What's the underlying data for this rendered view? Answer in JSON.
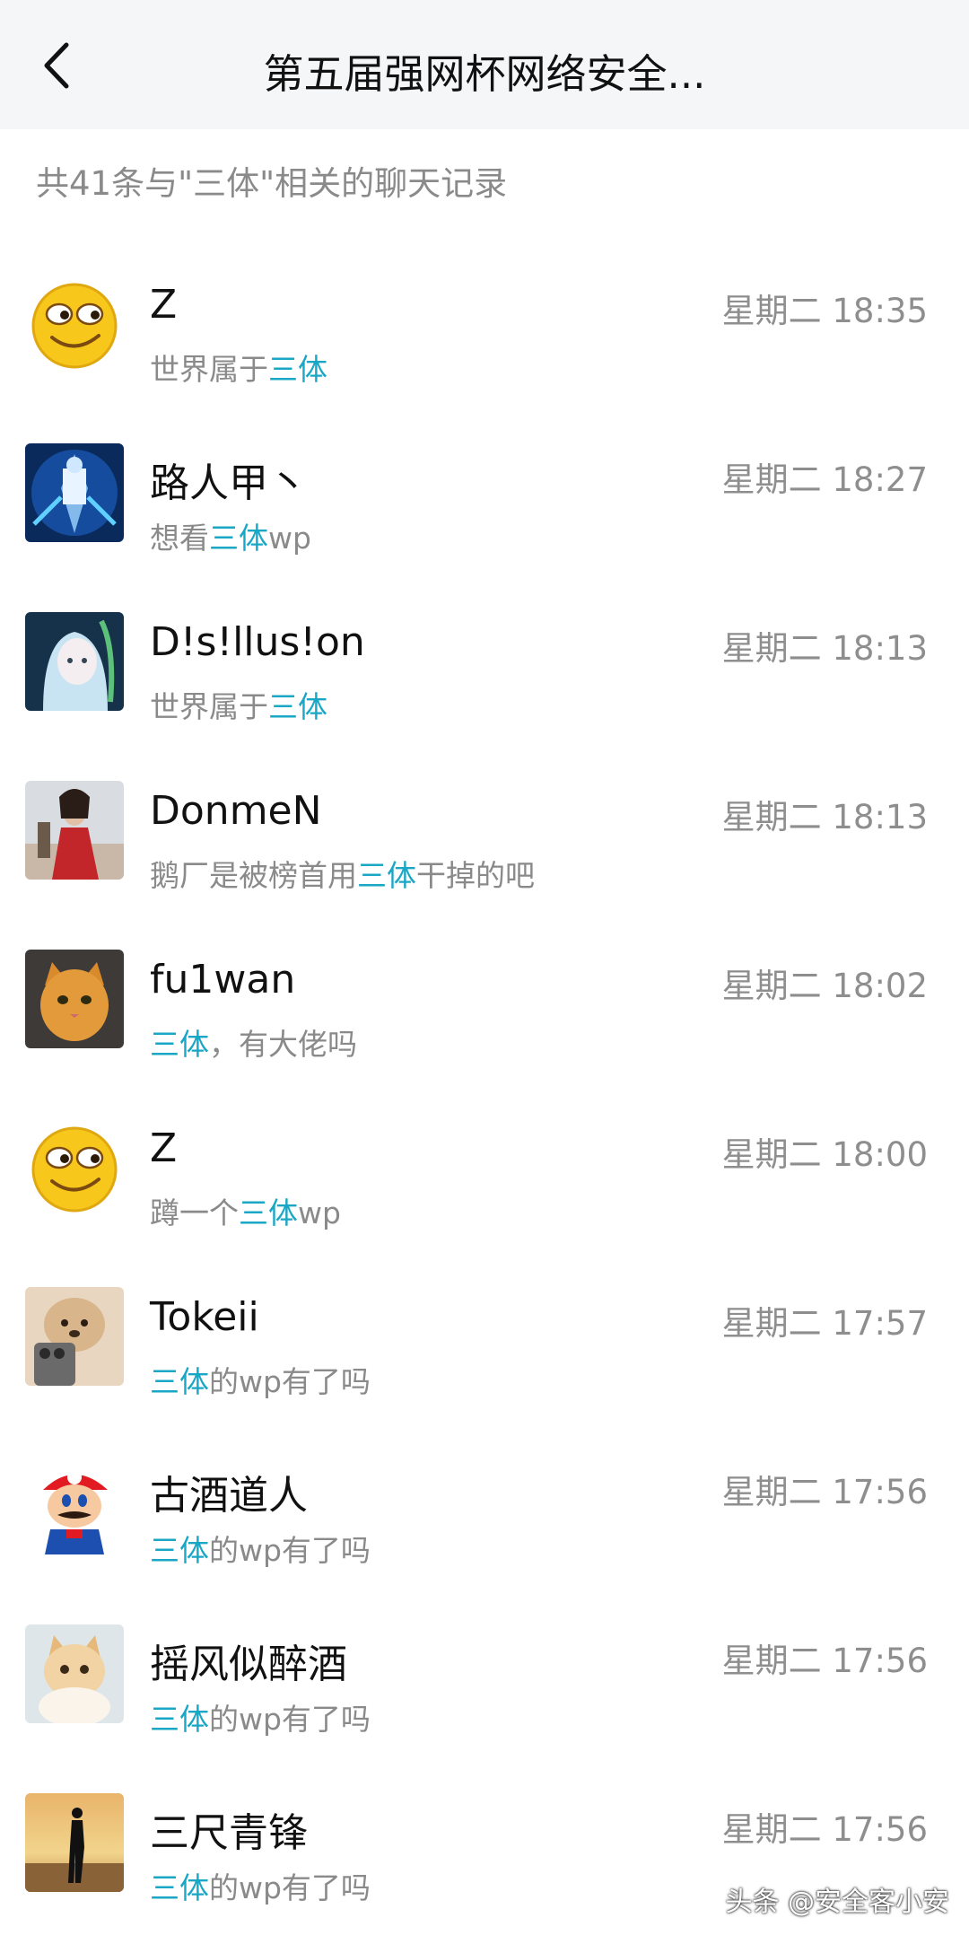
{
  "header": {
    "title": "第五届强网杯网络安全...",
    "back_icon": "chevron-left-icon"
  },
  "summary": "共41条与\"三体\"相关的聊天记录",
  "results": [
    {
      "name": "Z",
      "time": "星期二 18:35",
      "before": "世界属于",
      "keyword": "三体",
      "after": "",
      "avatar": "emoji-face"
    },
    {
      "name": "路人甲丶",
      "time": "星期二 18:27",
      "before": "想看",
      "keyword": "三体",
      "after": "wp",
      "avatar": "blue-robot"
    },
    {
      "name": "D!s!llus!on",
      "time": "星期二 18:13",
      "before": "世界属于",
      "keyword": "三体",
      "after": "",
      "avatar": "anime-girl"
    },
    {
      "name": "DonmeN",
      "time": "星期二 18:13",
      "before": "鹅厂是被榜首用",
      "keyword": "三体",
      "after": "干掉的吧",
      "avatar": "red-robe"
    },
    {
      "name": "fu1wan",
      "time": "星期二 18:02",
      "before": "",
      "keyword": "三体",
      "after": "，有大佬吗",
      "avatar": "orange-cat"
    },
    {
      "name": "Z",
      "time": "星期二 18:00",
      "before": "蹲一个",
      "keyword": "三体",
      "after": "wp",
      "avatar": "emoji-face"
    },
    {
      "name": "Tokeii",
      "time": "星期二 17:57",
      "before": "",
      "keyword": "三体",
      "after": "的wp有了吗",
      "avatar": "dog-phone"
    },
    {
      "name": "古酒道人",
      "time": "星期二 17:56",
      "before": "",
      "keyword": "三体",
      "after": "的wp有了吗",
      "avatar": "mario"
    },
    {
      "name": "摇风似醉酒",
      "time": "星期二 17:56",
      "before": "",
      "keyword": "三体",
      "after": "的wp有了吗",
      "avatar": "cream-cat"
    },
    {
      "name": "三尺青锋",
      "time": "星期二 17:56",
      "before": "",
      "keyword": "三体",
      "after": "的wp有了吗",
      "avatar": "sunset-silhouette"
    }
  ],
  "watermark": "头条 @安全客小安",
  "colors": {
    "header_bg": "#f5f6f8",
    "keyword": "#1aa7c6",
    "secondary_text": "#8a8a8a"
  }
}
